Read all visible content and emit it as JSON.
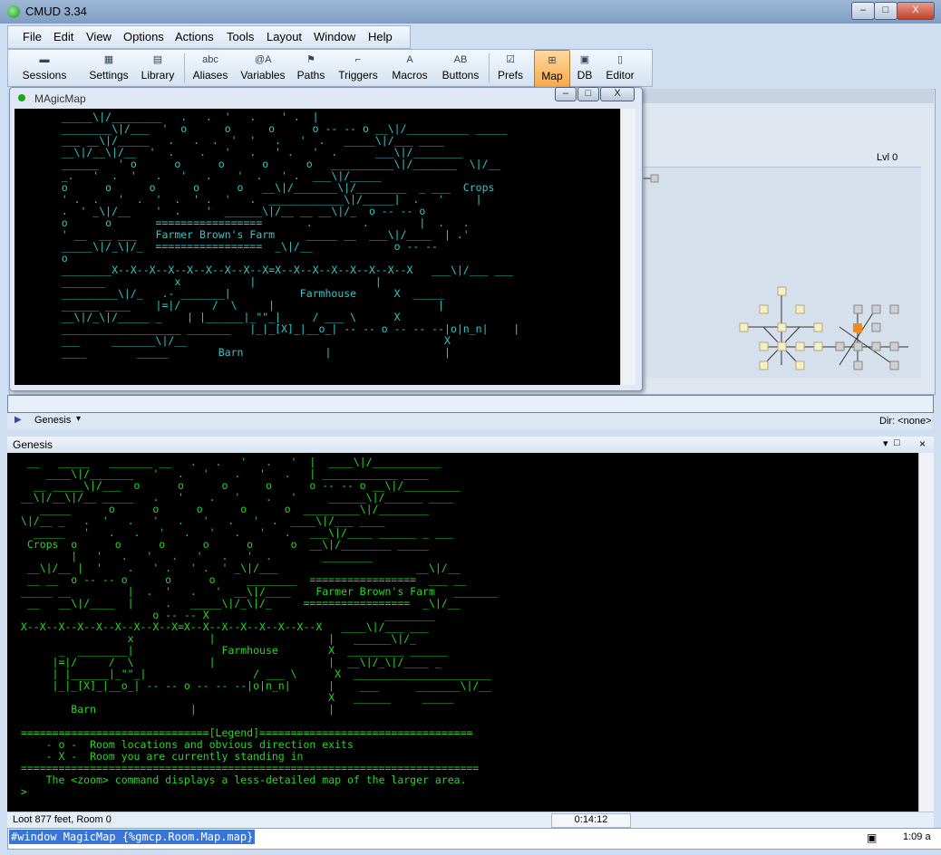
{
  "app": {
    "title": "CMUD 3.34"
  },
  "window_buttons": {
    "minimize": "–",
    "maximize": "□",
    "close": "X"
  },
  "menu": [
    "File",
    "Edit",
    "View",
    "Options",
    "Actions",
    "Tools",
    "Layout",
    "Window",
    "Help"
  ],
  "toolbar": [
    {
      "label": "Sessions",
      "icon": "folder-icon"
    },
    {
      "label": "Settings",
      "icon": "settings-icon"
    },
    {
      "label": "Library",
      "icon": "library-icon"
    },
    {
      "label": "Aliases",
      "icon": "aliases-icon",
      "glyph": "abc"
    },
    {
      "label": "Variables",
      "icon": "variables-icon",
      "glyph": "@A"
    },
    {
      "label": "Paths",
      "icon": "paths-icon"
    },
    {
      "label": "Triggers",
      "icon": "triggers-icon"
    },
    {
      "label": "Macros",
      "icon": "macros-icon",
      "glyph": "A"
    },
    {
      "label": "Buttons",
      "icon": "buttons-icon",
      "glyph": "AB"
    },
    {
      "label": "Prefs",
      "icon": "prefs-icon"
    },
    {
      "label": "Map",
      "icon": "map-icon"
    },
    {
      "label": "DB",
      "icon": "db-icon"
    },
    {
      "label": "Editor",
      "icon": "editor-icon"
    }
  ],
  "mapper": {
    "level": "Lvl 0"
  },
  "magicmap": {
    "title": "MAgicMap",
    "map_text": "    _____\\|/________   .   .  '   .    ' .  |\n    ________\\|/___  '  o      o      o      o -- -- o __\\|/__________ _____\n    ___ __\\|/_____   .   .  .  '  '   .   '  .   _____\\|/___ ____\n    __\\|/__\\|/__  '  .    .   '   .   ' .   '  .      ___\\|/________\n    ______   ' o      o      o      o      o   __________\\|/_______  \\|/__\n    _.   '  .  '   .   '   .    '  .   ' .  ___\\|/_____\n    o      o      o      o      o   __\\|/_______\\|/________  _ ___  Crops\n    ' .  .   '  .  '  .  ' .  '   .  ____________\\|/_____|  .   '     |\n    .  ' _\\|/__    '  .    '  ______\\|/__ __ __\\|/_  o -- -- o\n    o      o       =================       .        .        |  .   .\n    ' __  __ ___   Farmer Brown's Farm     _____ __  ___\\|/____  | .' \n    _____\\|/_\\|/_  =================  _\\|/__             o -- --\n    o\n    ________X--X--X--X--X--X--X--X--X=X--X--X--X--X--X--X--X   ___\\|/___ ___\n    _______           x           |                   |\n    _________\\|/_   .- _______|           Farmhouse      X  _____\n    ______ ____    |=|/     /  \\     |                          |\n    __\\|/_\\|/_____ _    | |______|_\"\"_|     / ___ \\      X\n    ___________________ _______   |_|_[X]_|__o_| -- -- o -- -- --|o|n_n|    |\n    ___     _______\\|/__                                         X\n    ____        _____        Barn             |                  |"
  },
  "command_window": {
    "profile": "Genesis",
    "direction": "Dir: <none>"
  },
  "genesis": {
    "title": "Genesis",
    "output": "  __   _____   _______ __   .   .   '   .   '  |  ____\\|/___________\n     ____\\|/_______   '   .   '    .   '   .   | ____________ ____\n   __ _____\\|/___  o      o      o      o      o -- -- o __\\|/_________\n __\\|/__\\|/__ _____   .   '    .   '    .   '     ______\\|/______ ____\n    _____      o      o      o      o      o  _________\\|/________\n \\|/__ _   .  '   .   '   .   '   .   '  .  ____\\|/___ ____\n   _____   '   .   .   '   .   '   .   '   .   ___\\|/____ ______ _ ___\n  Crops  o      o      o      o      o      o  __\\|/________ _____\n         |   '   .   '   .   '   .   '  .        ________\n  __\\|/__ |  '    .   ' .   ' .  ' _\\|/___                      __\\|/__\n  __ __  o -- -- o      o      o     ________  =================  ___ __\n _____ __         |  .  '   .   '  __\\|/____    Farmer Brown's Farm   _______\n  __   __\\|/____  |     .   _____\\|/_\\|/_     =================  _\\|/__\n                      o -- -- X                            ________\n X--X--X--X--X--X--X--X--X=X--X--X--X--X--X--X--X   ____\\|/___ ___\n                  x            |                  |   ______\\|/_\n       _  ________|              Farmhouse        X  _________ ______\n      |=|/     /  \\            |                  |  __\\|/_\\|/____ _\n      | |______|_\"\"_|                 / ___ \\      X  ______________________\n      |_|_[X]_|__o_| -- -- o -- -- --|o|n_n|      |    ___      _______\\|/__\n                                                  X   ______     _____\n         Barn               |                     |\n\n ==============================[Legend]==================================\n     - o -  Room locations and obvious direction exits\n     - X -  Room you are currently standing in\n =========================================================================\n     The <zoom> command displays a less-detailed map of the larger area.\n >"
  },
  "status": {
    "left": "Loot 877 feet, Room 0",
    "timer": "0:14:12",
    "clock": "1:09 a"
  },
  "input": {
    "value": "#window MagicMap {%gmcp.Room.Map.map}"
  }
}
